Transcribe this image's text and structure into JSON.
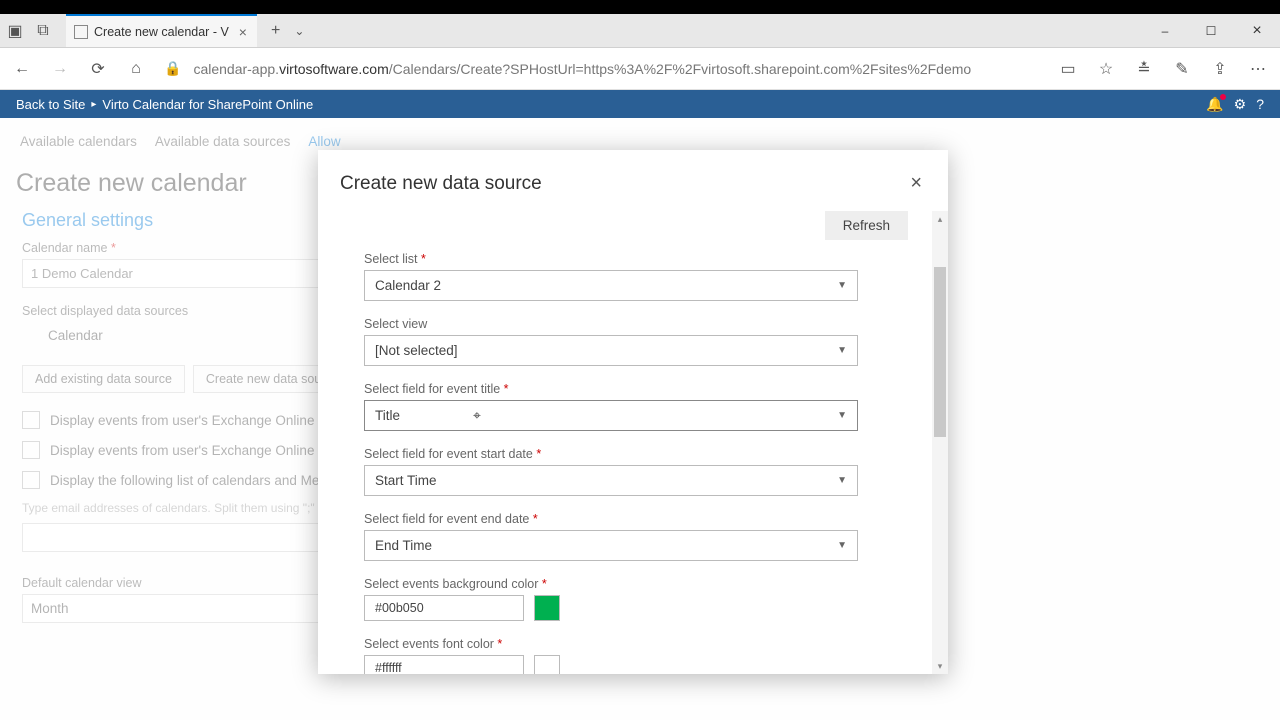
{
  "titlebar": {
    "tab_title": "Create new calendar - V",
    "minimize": "–",
    "maximize": "☐",
    "close": "×"
  },
  "addressbar": {
    "url_pre": "calendar-app.",
    "url_domain": "virtosoftware.com",
    "url_post": "/Calendars/Create?SPHostUrl=https%3A%2F%2Fvirtosoft.sharepoint.com%2Fsites%2Fdemo"
  },
  "breadcrumb": {
    "back": "Back to Site",
    "app": "Virto Calendar for SharePoint Online"
  },
  "tabs": {
    "available_calendars": "Available calendars",
    "available_data_sources": "Available data sources",
    "allow": "Allow"
  },
  "page": {
    "title": "Create new calendar",
    "section": "General settings",
    "calendar_name_label": "Calendar name",
    "calendar_name_value": "1 Demo Calendar",
    "ds_label": "Select displayed data sources",
    "ds_item": "Calendar",
    "btn_add_existing": "Add existing data source",
    "btn_create_new": "Create new data source",
    "chk_exchange": "Display events from user's Exchange Online Calen",
    "chk_exchange_share": "Display events from user's Exchange Online Share",
    "chk_calendar_list": "Display the following list of calendars and Meetin",
    "hint": "Type email addresses of calendars. Split them using \";\"",
    "default_view_label": "Default calendar view",
    "default_view_value": "Month"
  },
  "modal": {
    "title": "Create new data source",
    "refresh": "Refresh",
    "fields": {
      "select_list": {
        "label": "Select list",
        "value": "Calendar 2",
        "required": true
      },
      "select_view": {
        "label": "Select view",
        "value": "[Not selected]",
        "required": false
      },
      "event_title": {
        "label": "Select field for event title",
        "value": "Title",
        "required": true
      },
      "start_date": {
        "label": "Select field for event start date",
        "value": "Start Time",
        "required": true
      },
      "end_date": {
        "label": "Select field for event end date",
        "value": "End Time",
        "required": true
      },
      "bg_color": {
        "label": "Select events background color",
        "value": "#00b050",
        "required": true
      },
      "font_color": {
        "label": "Select events font color",
        "value": "#ffffff",
        "required": true
      }
    }
  }
}
